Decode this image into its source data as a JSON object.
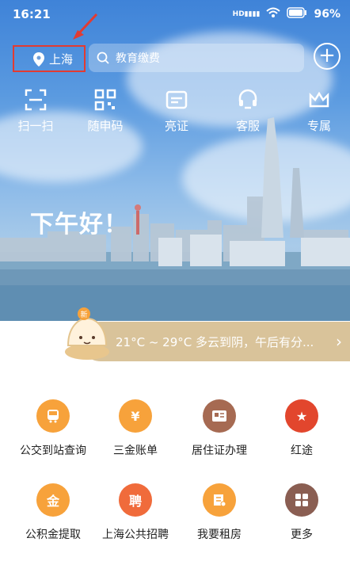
{
  "status_bar": {
    "time": "16:21",
    "network": "HD",
    "battery": "96"
  },
  "location": {
    "city": "上海"
  },
  "search": {
    "placeholder": "教育缴费"
  },
  "quick_actions": [
    {
      "label": "扫一扫",
      "icon": "scan-icon"
    },
    {
      "label": "随申码",
      "icon": "qr-code-icon"
    },
    {
      "label": "亮证",
      "icon": "card-icon"
    },
    {
      "label": "客服",
      "icon": "customer-service-icon"
    },
    {
      "label": "专属",
      "icon": "crown-icon"
    }
  ],
  "greeting": "下午好！",
  "weather": {
    "text": "21°C ~ 29°C  多云到阴，午后有分..."
  },
  "badge": {
    "label": "新"
  },
  "services": [
    {
      "label": "公交到站查询",
      "icon": "bus-icon",
      "color": "#f7a23b"
    },
    {
      "label": "三金账单",
      "icon": "money-house-icon",
      "color": "#f7a23b"
    },
    {
      "label": "居住证办理",
      "icon": "id-card-icon",
      "color": "#a66a52"
    },
    {
      "label": "红途",
      "icon": "red-star-icon",
      "color": "#e2462d"
    },
    {
      "label": "公积金提取",
      "icon": "fund-bag-icon",
      "color": "#f7a23b"
    },
    {
      "label": "上海公共招聘",
      "icon": "recruit-icon",
      "color": "#f06b3b"
    },
    {
      "label": "我要租房",
      "icon": "rent-house-icon",
      "color": "#f7a23b"
    },
    {
      "label": "更多",
      "icon": "more-grid-icon",
      "color": "#8a5e52"
    }
  ],
  "service_icon_text": {
    "salary": "¥",
    "recruit": "聘",
    "fund": "金"
  }
}
